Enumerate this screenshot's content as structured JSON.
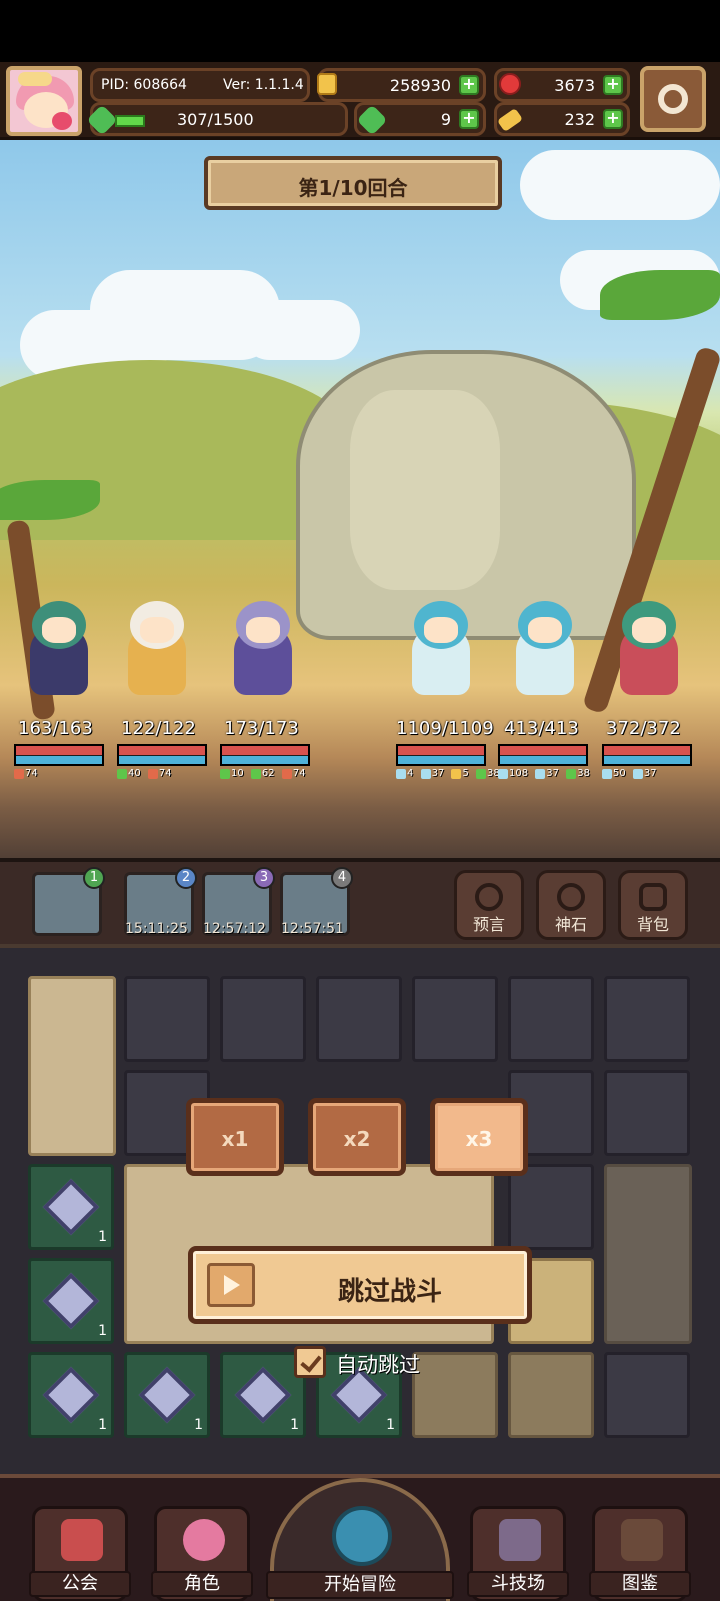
{
  "header": {
    "pid": "PID: 608664",
    "version": "Ver: 1.1.1.4",
    "gold": "258930",
    "apples": "3673",
    "exp": "307/1500",
    "clovers": "9",
    "keys": "232"
  },
  "battle": {
    "round": "第1/10回合",
    "allies": [
      {
        "hp": "163/163",
        "buffs": [
          "74"
        ]
      },
      {
        "hp": "122/122",
        "buffs": [
          "40",
          "74"
        ]
      },
      {
        "hp": "173/173",
        "buffs": [
          "10",
          "62",
          "74"
        ]
      }
    ],
    "enemies": [
      {
        "hp": "1109/1109",
        "buffs": [
          "4",
          "37",
          "5",
          "38"
        ]
      },
      {
        "hp": "413/413",
        "buffs": [
          "108",
          "37",
          "38"
        ]
      },
      {
        "hp": "372/372",
        "buffs": [
          "50",
          "37"
        ]
      }
    ]
  },
  "queue": {
    "slots": [
      {
        "badge": "1",
        "time": ""
      },
      {
        "badge": "2",
        "time": "15:11:25"
      },
      {
        "badge": "3",
        "time": "12:57:12"
      },
      {
        "badge": "4",
        "time": "12:57:51"
      }
    ],
    "tools": [
      "预言",
      "神石",
      "背包"
    ]
  },
  "inventory": {
    "item_count": "1"
  },
  "speed": {
    "x1": "x1",
    "x2": "x2",
    "x3": "x3",
    "selected": "x3"
  },
  "skip_button": "跳过战斗",
  "auto_skip": "自动跳过",
  "nav": {
    "guild": "公会",
    "characters": "角色",
    "start_adventure": "开始冒险",
    "arena": "斗技场",
    "codex": "图鉴"
  }
}
